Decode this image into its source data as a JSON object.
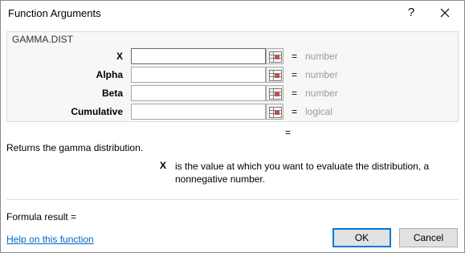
{
  "window": {
    "title": "Function Arguments",
    "help_label": "?"
  },
  "function_name": "GAMMA.DIST",
  "arguments": [
    {
      "label": "X",
      "value": "",
      "equals": "=",
      "hint": "number"
    },
    {
      "label": "Alpha",
      "value": "",
      "equals": "=",
      "hint": "number"
    },
    {
      "label": "Beta",
      "value": "",
      "equals": "=",
      "hint": "number"
    },
    {
      "label": "Cumulative",
      "value": "",
      "equals": "=",
      "hint": "logical"
    }
  ],
  "result_equals": "=",
  "description": "Returns the gamma distribution.",
  "argument_help": {
    "name": "X",
    "text": "is the value at which you want to evaluate the distribution, a nonnegative number."
  },
  "formula_result_label": "Formula result =",
  "help_link": "Help on this function",
  "buttons": {
    "ok": "OK",
    "cancel": "Cancel"
  },
  "colors": {
    "link": "#0066cc",
    "hint": "#9a9a9a",
    "focus": "#0078d7"
  },
  "icons": {
    "close": "close-icon",
    "collapse": "collapse-dialog-icon"
  }
}
